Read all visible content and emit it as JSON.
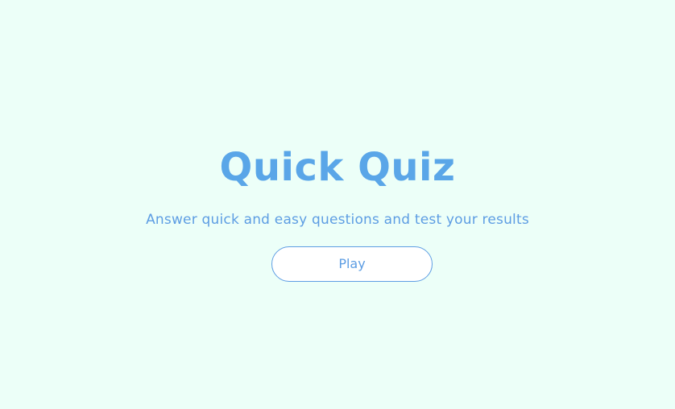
{
  "home": {
    "title": "Quick Quiz",
    "subtitle": "Answer quick and easy questions and test your results",
    "play_label": "Play"
  },
  "theme": {
    "background": "#ecfff8",
    "accent": "#5aa6e8",
    "button_background": "#ffffff"
  }
}
